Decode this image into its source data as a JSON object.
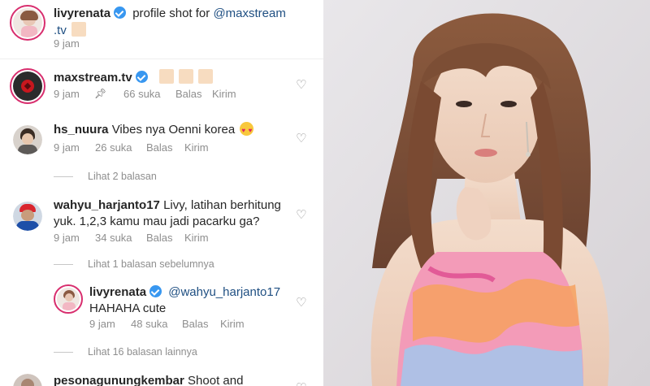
{
  "caption": {
    "username": "livyrenata",
    "text_prefix": "profile shot for",
    "mention_part1": "@maxstream",
    "mention_part2": ".tv",
    "time": "9 jam"
  },
  "comments": [
    {
      "username": "maxstream.tv",
      "time": "9 jam",
      "likes": "66 suka",
      "reply": "Balas",
      "send": "Kirim"
    },
    {
      "username": "hs_nuura",
      "text": "Vibes nya Oenni korea",
      "time": "9 jam",
      "likes": "26 suka",
      "reply": "Balas",
      "send": "Kirim",
      "replies_link": "Lihat 2 balasan"
    },
    {
      "username": "wahyu_harjanto17",
      "text_line1": "Livy, latihan berhitung",
      "text_line2": "yuk. 1,2,3 kamu mau jadi pacarku ga?",
      "time": "9 jam",
      "likes": "34 suka",
      "reply": "Balas",
      "send": "Kirim",
      "replies_link": "Lihat 1 balasan sebelumnya"
    },
    {
      "username": "livyrenata",
      "mention": "@wahyu_harjanto17",
      "text": "HAHAHA cute",
      "time": "9 jam",
      "likes": "48 suka",
      "reply": "Balas",
      "send": "Kirim",
      "replies_link": "Lihat 16 balasan lainnya"
    },
    {
      "username": "pesonagunungkembar",
      "text": "Shoot and"
    }
  ],
  "icons": {
    "heart": "heart-outline-icon",
    "pin": "pin-icon",
    "verified": "verified-badge-icon"
  },
  "colors": {
    "verified": "#3897f0",
    "mention": "#1f4f82",
    "meta": "#8e8e8e",
    "story_ring": "#d82e6e"
  }
}
